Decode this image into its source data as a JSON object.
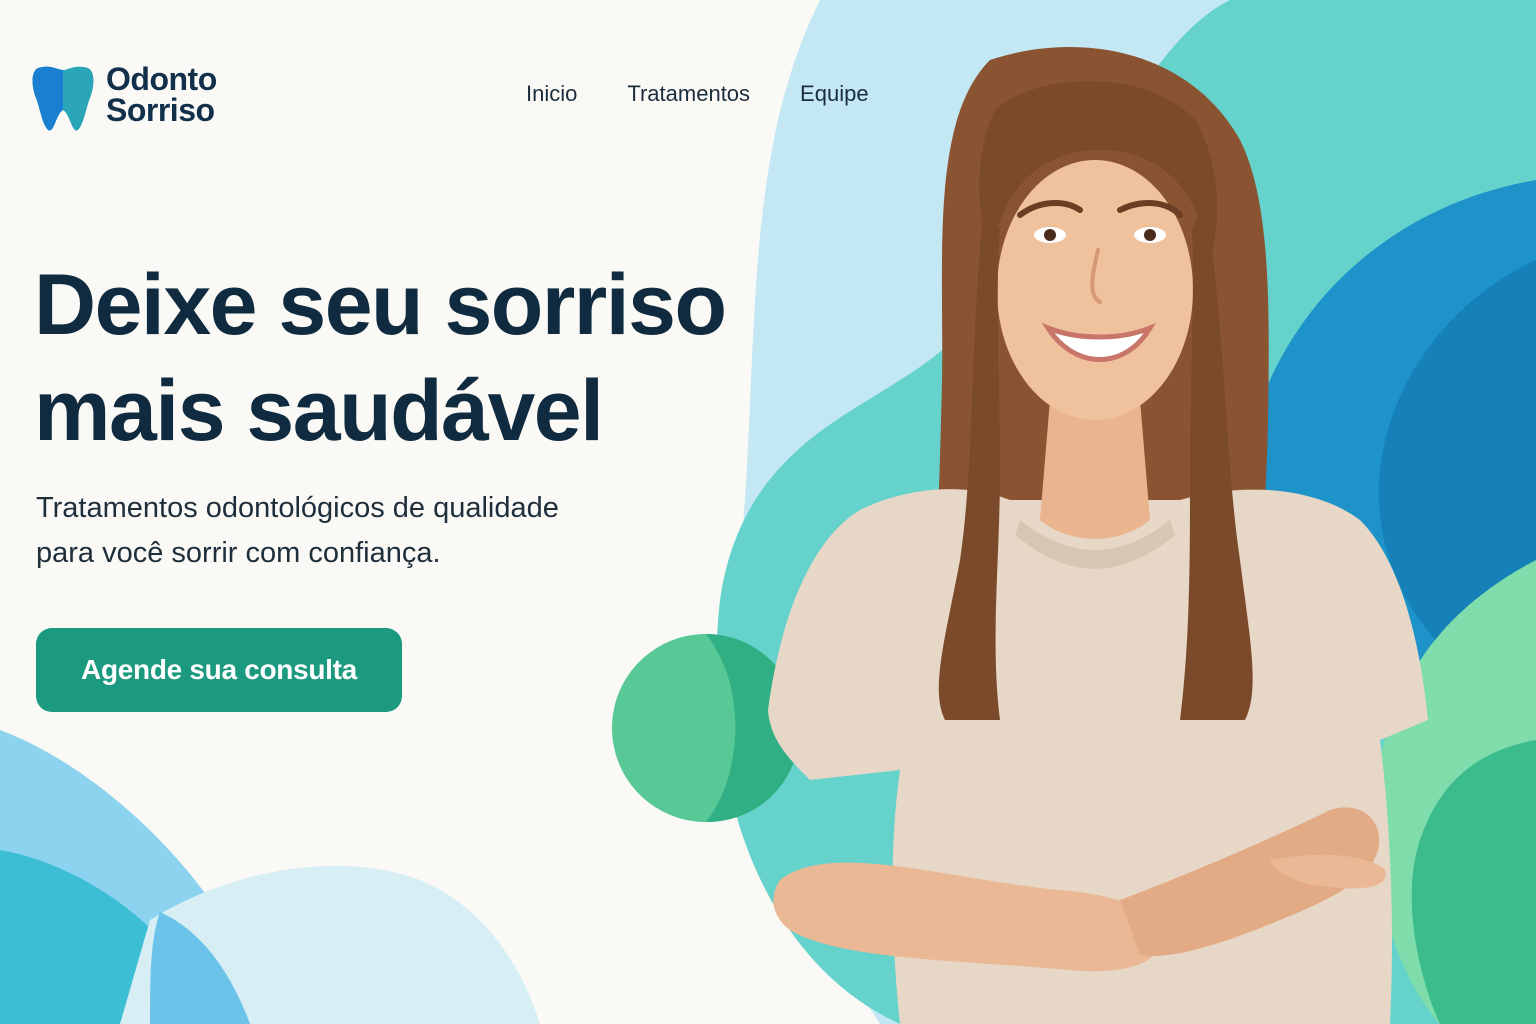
{
  "brand": {
    "name_line1": "Odonto",
    "name_line2": "Sorriso"
  },
  "nav": {
    "items": [
      "Inicio",
      "Tratamentos",
      "Equipe"
    ]
  },
  "hero": {
    "title_line1": "Deixe seu sorriso",
    "title_line2": "mais saudável",
    "subtitle_line1": "Tratamentos odontológicos de qualidade",
    "subtitle_line2": "para você sorrir com confiança.",
    "cta_label": "Agende sua consulta"
  },
  "colors": {
    "background": "#faf9f6",
    "heading": "#102b3f",
    "cta": "#1b9a7f",
    "accent_light_blue": "#bfe6f2",
    "accent_teal": "#5ccfc9",
    "accent_blue": "#1a8cc4",
    "accent_green": "#4fc594"
  },
  "icons": {
    "logo": "tooth-icon"
  },
  "image": {
    "subject": "smiling-woman-photo"
  }
}
